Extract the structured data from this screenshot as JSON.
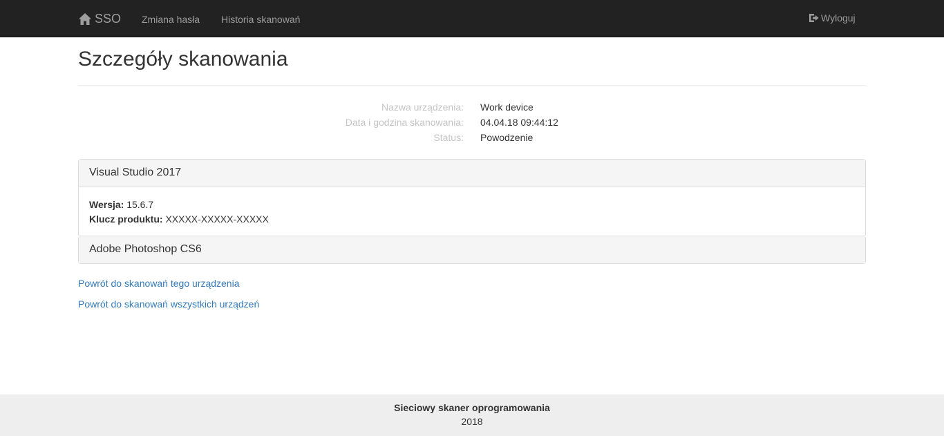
{
  "navbar": {
    "brand": "SSO",
    "links": [
      "Zmiana hasła",
      "Historia skanowań"
    ],
    "logout": "Wyloguj"
  },
  "page": {
    "title": "Szczegóły skanowania"
  },
  "details": [
    {
      "label": "Nazwa urządzenia:",
      "value": "Work device"
    },
    {
      "label": "Data i godzina skanowania:",
      "value": "04.04.18 09:44:12"
    },
    {
      "label": "Status:",
      "value": "Powodzenie"
    }
  ],
  "panels": [
    {
      "title": "Visual Studio 2017",
      "version_label": "Wersja:",
      "version": "15.6.7",
      "key_label": "Klucz produktu:",
      "key": "XXXXX-XXXXX-XXXXX"
    },
    {
      "title": "Adobe Photoshop CS6"
    }
  ],
  "links": {
    "back_device": "Powrót do skanowań tego urządzenia",
    "back_all": "Powrót do skanowań wszystkich urządzeń"
  },
  "footer": {
    "title": "Sieciowy skaner oprogramowania",
    "year": "2018"
  }
}
